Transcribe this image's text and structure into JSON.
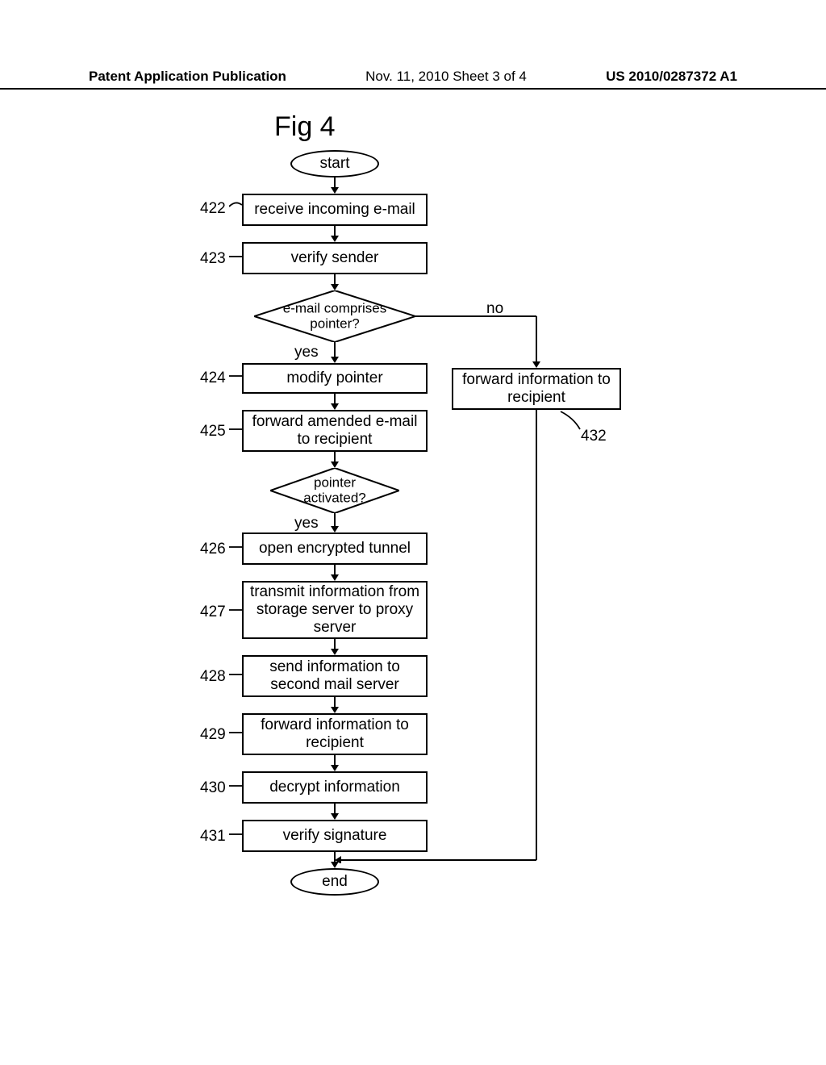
{
  "header": {
    "left": "Patent Application Publication",
    "center": "Nov. 11, 2010  Sheet 3 of 4",
    "right": "US 2010/0287372 A1"
  },
  "fig_title": "Fig 4",
  "terminators": {
    "start": "start",
    "end": "end"
  },
  "steps": {
    "s422": "receive incoming e-mail",
    "s423": "verify sender",
    "s424": "modify pointer",
    "s425": "forward amended e-mail to recipient",
    "s426": "open encrypted tunnel",
    "s427": "transmit information from storage server to proxy server",
    "s428": "send information to second mail server",
    "s429": "forward information to recipient",
    "s430": "decrypt information",
    "s431": "verify signature",
    "s432": "forward information to recipient"
  },
  "decisions": {
    "d1": "e-mail comprises pointer?",
    "d2": "pointer activated?"
  },
  "labels": {
    "yes": "yes",
    "no": "no"
  },
  "nums": {
    "n422": "422",
    "n423": "423",
    "n424": "424",
    "n425": "425",
    "n426": "426",
    "n427": "427",
    "n428": "428",
    "n429": "429",
    "n430": "430",
    "n431": "431",
    "n432": "432"
  },
  "chart_data": {
    "type": "flowchart",
    "title": "Fig 4",
    "nodes": [
      {
        "id": "start",
        "type": "terminator",
        "label": "start"
      },
      {
        "id": "422",
        "type": "process",
        "label": "receive incoming e-mail"
      },
      {
        "id": "423",
        "type": "process",
        "label": "verify sender"
      },
      {
        "id": "d1",
        "type": "decision",
        "label": "e-mail comprises pointer?"
      },
      {
        "id": "424",
        "type": "process",
        "label": "modify pointer"
      },
      {
        "id": "425",
        "type": "process",
        "label": "forward amended e-mail to recipient"
      },
      {
        "id": "d2",
        "type": "decision",
        "label": "pointer activated?"
      },
      {
        "id": "426",
        "type": "process",
        "label": "open encrypted tunnel"
      },
      {
        "id": "427",
        "type": "process",
        "label": "transmit information from storage server to proxy server"
      },
      {
        "id": "428",
        "type": "process",
        "label": "send information to second mail server"
      },
      {
        "id": "429",
        "type": "process",
        "label": "forward information to recipient"
      },
      {
        "id": "430",
        "type": "process",
        "label": "decrypt information"
      },
      {
        "id": "431",
        "type": "process",
        "label": "verify signature"
      },
      {
        "id": "432",
        "type": "process",
        "label": "forward information to recipient"
      },
      {
        "id": "end",
        "type": "terminator",
        "label": "end"
      }
    ],
    "edges": [
      {
        "from": "start",
        "to": "422"
      },
      {
        "from": "422",
        "to": "423"
      },
      {
        "from": "423",
        "to": "d1"
      },
      {
        "from": "d1",
        "to": "424",
        "label": "yes"
      },
      {
        "from": "d1",
        "to": "432",
        "label": "no"
      },
      {
        "from": "424",
        "to": "425"
      },
      {
        "from": "425",
        "to": "d2"
      },
      {
        "from": "d2",
        "to": "426",
        "label": "yes"
      },
      {
        "from": "426",
        "to": "427"
      },
      {
        "from": "427",
        "to": "428"
      },
      {
        "from": "428",
        "to": "429"
      },
      {
        "from": "429",
        "to": "430"
      },
      {
        "from": "430",
        "to": "431"
      },
      {
        "from": "431",
        "to": "end"
      },
      {
        "from": "432",
        "to": "end"
      }
    ]
  }
}
